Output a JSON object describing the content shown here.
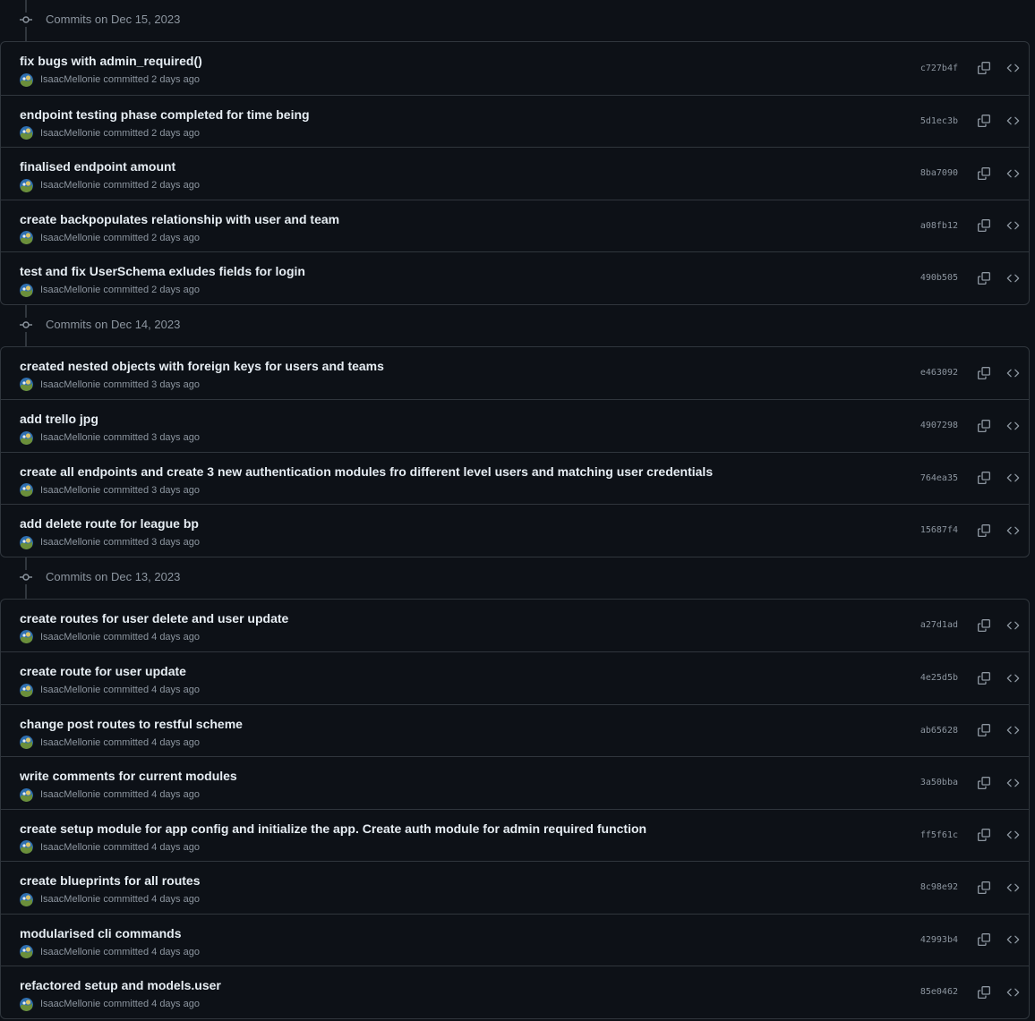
{
  "groups": [
    {
      "date_label": "Commits on Dec 15, 2023",
      "commits": [
        {
          "message": "fix bugs with admin_required()",
          "author": "IsaacMellonie",
          "verb": "committed",
          "time": "2 days ago",
          "sha": "c727b4f"
        },
        {
          "message": "endpoint testing phase completed for time being",
          "author": "IsaacMellonie",
          "verb": "committed",
          "time": "2 days ago",
          "sha": "5d1ec3b"
        },
        {
          "message": "finalised endpoint amount",
          "author": "IsaacMellonie",
          "verb": "committed",
          "time": "2 days ago",
          "sha": "8ba7090"
        },
        {
          "message": "create backpopulates relationship with user and team",
          "author": "IsaacMellonie",
          "verb": "committed",
          "time": "2 days ago",
          "sha": "a08fb12"
        },
        {
          "message": "test and fix UserSchema exludes fields for login",
          "author": "IsaacMellonie",
          "verb": "committed",
          "time": "2 days ago",
          "sha": "490b505"
        }
      ]
    },
    {
      "date_label": "Commits on Dec 14, 2023",
      "commits": [
        {
          "message": "created nested objects with foreign keys for users and teams",
          "author": "IsaacMellonie",
          "verb": "committed",
          "time": "3 days ago",
          "sha": "e463092"
        },
        {
          "message": "add trello jpg",
          "author": "IsaacMellonie",
          "verb": "committed",
          "time": "3 days ago",
          "sha": "4907298"
        },
        {
          "message": "create all endpoints and create 3 new authentication modules fro different level users and matching user credentials",
          "author": "IsaacMellonie",
          "verb": "committed",
          "time": "3 days ago",
          "sha": "764ea35"
        },
        {
          "message": "add delete route for league bp",
          "author": "IsaacMellonie",
          "verb": "committed",
          "time": "3 days ago",
          "sha": "15687f4"
        }
      ]
    },
    {
      "date_label": "Commits on Dec 13, 2023",
      "commits": [
        {
          "message": "create routes for user delete and user update",
          "author": "IsaacMellonie",
          "verb": "committed",
          "time": "4 days ago",
          "sha": "a27d1ad"
        },
        {
          "message": "create route for user update",
          "author": "IsaacMellonie",
          "verb": "committed",
          "time": "4 days ago",
          "sha": "4e25d5b"
        },
        {
          "message": "change post routes to restful scheme",
          "author": "IsaacMellonie",
          "verb": "committed",
          "time": "4 days ago",
          "sha": "ab65628"
        },
        {
          "message": "write comments for current modules",
          "author": "IsaacMellonie",
          "verb": "committed",
          "time": "4 days ago",
          "sha": "3a50bba"
        },
        {
          "message": "create setup module for app config and initialize the app. Create auth module for admin required function",
          "author": "IsaacMellonie",
          "verb": "committed",
          "time": "4 days ago",
          "sha": "ff5f61c"
        },
        {
          "message": "create blueprints for all routes",
          "author": "IsaacMellonie",
          "verb": "committed",
          "time": "4 days ago",
          "sha": "8c98e92"
        },
        {
          "message": "modularised cli commands",
          "author": "IsaacMellonie",
          "verb": "committed",
          "time": "4 days ago",
          "sha": "42993b4"
        },
        {
          "message": "refactored setup and models.user",
          "author": "IsaacMellonie",
          "verb": "committed",
          "time": "4 days ago",
          "sha": "85e0462"
        }
      ]
    }
  ],
  "icons": {
    "timeline_node": "git-commit-icon",
    "avatar": "user-avatar",
    "copy": "copy-icon",
    "browse": "code-icon"
  },
  "colors": {
    "background": "#0d1117",
    "border": "#30363d",
    "text_primary": "#e6edf3",
    "text_muted": "#8d96a0"
  }
}
